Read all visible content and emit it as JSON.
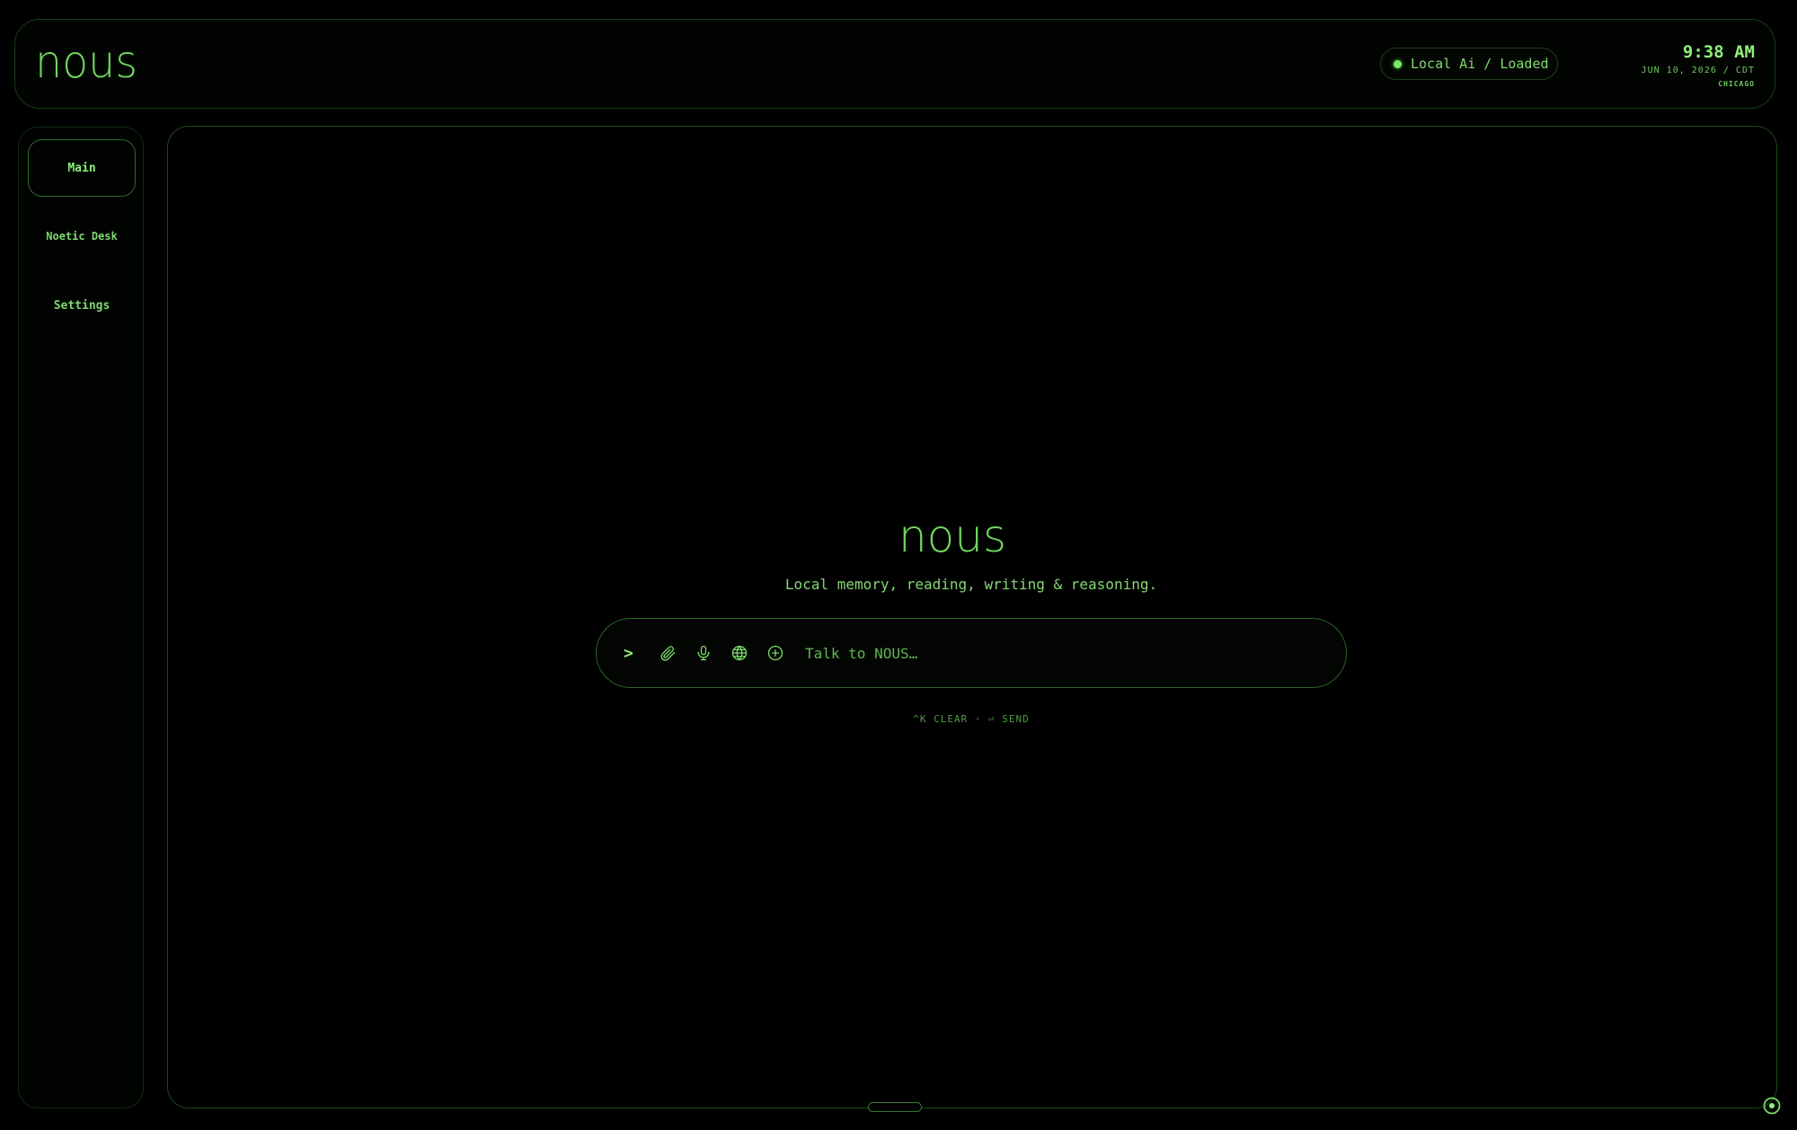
{
  "header": {
    "brand": "nous",
    "status": {
      "label": "Local Ai / Loaded",
      "dot_color": "#7ae864"
    },
    "clock": {
      "time": "9:38 AM",
      "date": "JUN 10, 2026 / CDT",
      "city": "CHICAGO"
    }
  },
  "sidebar": {
    "items": [
      {
        "label": "Main",
        "active": true
      },
      {
        "label": "Noetic Desk",
        "active": false
      },
      {
        "label": "Settings",
        "active": false
      }
    ]
  },
  "main": {
    "title": "nous",
    "subtitle": "Local memory, reading, writing & reasoning.",
    "prompt": {
      "caret": ">",
      "placeholder": "Talk to NOUS…",
      "value": "",
      "icons": [
        "paperclip-icon",
        "microphone-icon",
        "globe-icon",
        "plus-circle-icon"
      ]
    },
    "hints": "^K CLEAR · ⏎ SEND"
  },
  "colors": {
    "accent": "#7ddc6a",
    "background": "#000000",
    "border": "#1c4a1a"
  }
}
